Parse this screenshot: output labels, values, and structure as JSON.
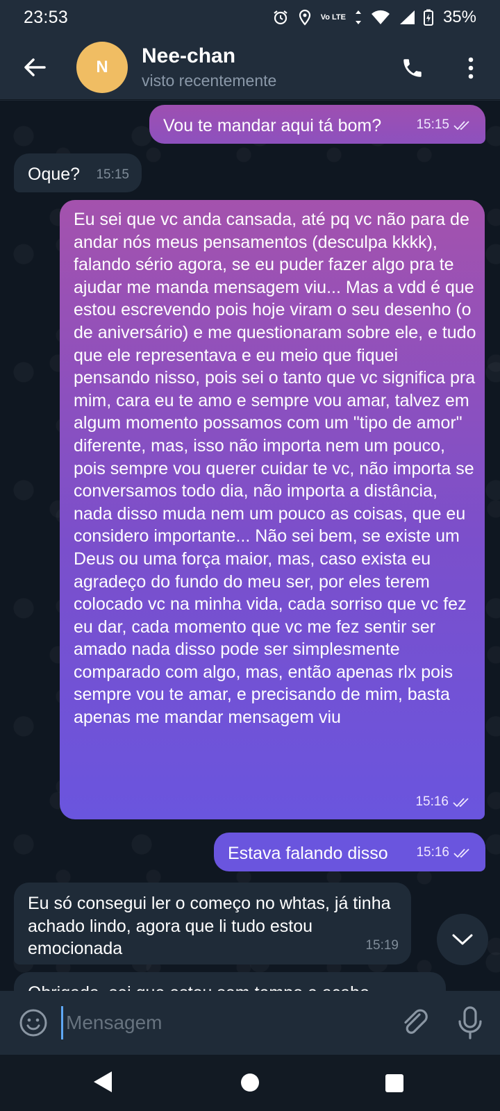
{
  "status_bar": {
    "time": "23:53",
    "network": "Vo LTE",
    "battery": "35%"
  },
  "header": {
    "avatar_letter": "N",
    "avatar_color": "#f0bd63",
    "name": "Nee-chan",
    "status": "visto recentemente"
  },
  "messages": [
    {
      "direction": "out",
      "text": "Vou te mandar aqui tá bom?",
      "time": "15:15",
      "read": true
    },
    {
      "direction": "in",
      "text": "Oque?",
      "time": "15:15"
    },
    {
      "direction": "out",
      "text": "Eu sei que vc anda cansada, até pq vc não para de andar nós meus pensamentos (desculpa kkkk), falando sério agora, se eu puder fazer algo pra te ajudar me manda mensagem viu... Mas a vdd é que estou escrevendo pois hoje viram o seu desenho (o de aniversário) e me questionaram sobre ele, e tudo que ele representava e eu meio que fiquei pensando nisso, pois sei o tanto que vc significa pra mim, cara eu te amo e sempre vou amar, talvez em algum momento possamos com um \"tipo de amor\" diferente, mas, isso não importa nem um pouco, pois sempre vou querer cuidar te vc, não importa se conversamos todo dia, não importa a distância, nada disso muda nem um pouco as coisas, que eu considero importante... Não sei bem, se existe um Deus ou uma força maior, mas, caso exista eu agradeço do fundo do meu ser, por eles terem colocado vc na minha vida, cada sorriso que vc fez eu dar, cada momento que vc me fez sentir ser amado nada disso pode ser simplesmente comparado com algo, mas, então apenas rlx pois sempre vou te amar, e precisando de mim, basta apenas me mandar mensagem viu",
      "time": "15:16",
      "read": true
    },
    {
      "direction": "out",
      "text": "Estava falando disso",
      "time": "15:16",
      "read": true
    },
    {
      "direction": "in",
      "text": "Eu só consegui ler o começo no whtas, já tinha achado lindo, agora que li tudo estou emocionada",
      "time": "15:19"
    },
    {
      "direction": "in",
      "text": "Obrigada, sei que estou sem tempo e acabo",
      "time": ""
    }
  ],
  "input": {
    "placeholder": "Mensagem"
  },
  "colors": {
    "outgoing_top": "#a452ad",
    "outgoing_bottom": "#6a55de",
    "incoming": "#1f2b38",
    "header": "#212d3b"
  },
  "icons": [
    "back-arrow-icon",
    "phone-icon",
    "more-vertical-icon",
    "chevron-down-icon",
    "emoji-icon",
    "paperclip-icon",
    "microphone-icon"
  ]
}
